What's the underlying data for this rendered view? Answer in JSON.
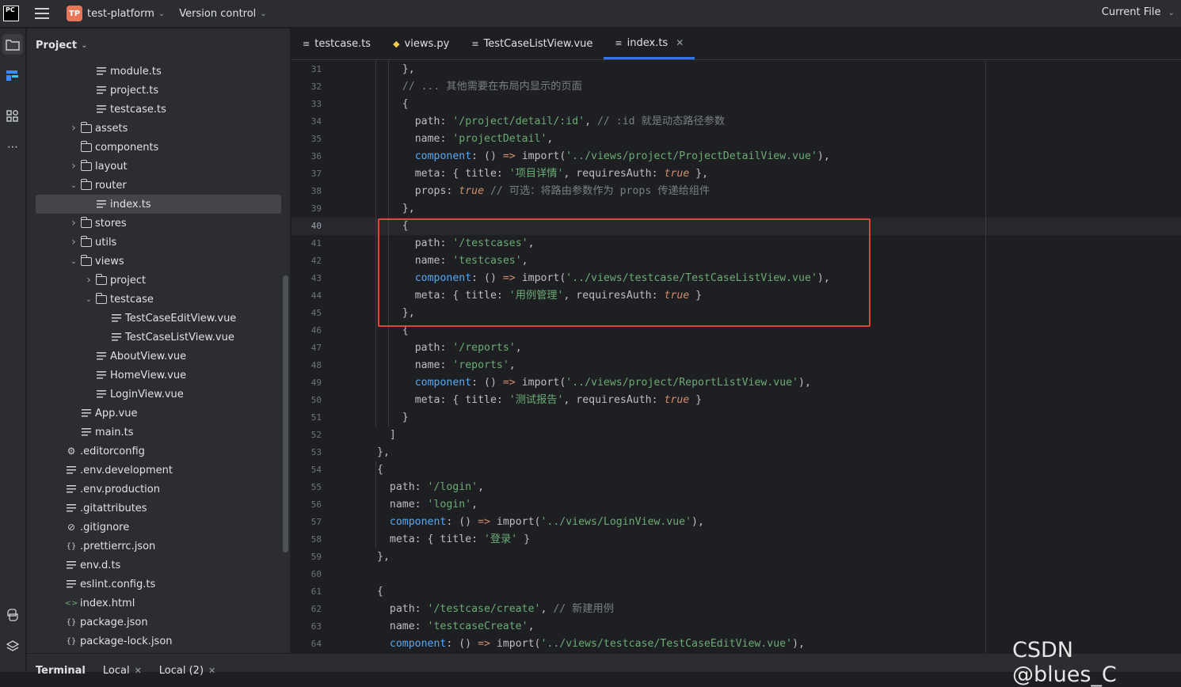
{
  "titlebar": {
    "app_logo": "PC",
    "project_badge": "TP",
    "project_name": "test-platform",
    "vcs_label": "Version control",
    "run_config": "Current File"
  },
  "left_strip": {
    "icons": [
      "folder-icon",
      "structure-icon",
      "plugins-icon",
      "more-icon",
      "python-console-icon",
      "layers-icon"
    ]
  },
  "project_panel": {
    "title": "Project",
    "tree": [
      {
        "label": "module.ts",
        "type": "file",
        "depth": 4
      },
      {
        "label": "project.ts",
        "type": "file",
        "depth": 4
      },
      {
        "label": "testcase.ts",
        "type": "file",
        "depth": 4
      },
      {
        "label": "assets",
        "type": "folder",
        "depth": 3,
        "expanded": false
      },
      {
        "label": "components",
        "type": "folder",
        "depth": 3,
        "expanded": null
      },
      {
        "label": "layout",
        "type": "folder",
        "depth": 3,
        "expanded": false
      },
      {
        "label": "router",
        "type": "folder",
        "depth": 3,
        "expanded": true
      },
      {
        "label": "index.ts",
        "type": "file",
        "depth": 4,
        "selected": true
      },
      {
        "label": "stores",
        "type": "folder",
        "depth": 3,
        "expanded": false
      },
      {
        "label": "utils",
        "type": "folder",
        "depth": 3,
        "expanded": false
      },
      {
        "label": "views",
        "type": "folder",
        "depth": 3,
        "expanded": true
      },
      {
        "label": "project",
        "type": "folder",
        "depth": 4,
        "expanded": false
      },
      {
        "label": "testcase",
        "type": "folder",
        "depth": 4,
        "expanded": true
      },
      {
        "label": "TestCaseEditView.vue",
        "type": "file",
        "depth": 5
      },
      {
        "label": "TestCaseListView.vue",
        "type": "file",
        "depth": 5
      },
      {
        "label": "AboutView.vue",
        "type": "file",
        "depth": 4
      },
      {
        "label": "HomeView.vue",
        "type": "file",
        "depth": 4
      },
      {
        "label": "LoginView.vue",
        "type": "file",
        "depth": 4
      },
      {
        "label": "App.vue",
        "type": "file",
        "depth": 3
      },
      {
        "label": "main.ts",
        "type": "file",
        "depth": 3
      },
      {
        "label": ".editorconfig",
        "type": "config",
        "depth": 2
      },
      {
        "label": ".env.development",
        "type": "file",
        "depth": 2
      },
      {
        "label": ".env.production",
        "type": "file",
        "depth": 2
      },
      {
        "label": ".gitattributes",
        "type": "file",
        "depth": 2
      },
      {
        "label": ".gitignore",
        "type": "ignore",
        "depth": 2
      },
      {
        "label": ".prettierrc.json",
        "type": "json",
        "depth": 2
      },
      {
        "label": "env.d.ts",
        "type": "file",
        "depth": 2
      },
      {
        "label": "eslint.config.ts",
        "type": "file",
        "depth": 2
      },
      {
        "label": "index.html",
        "type": "html",
        "depth": 2
      },
      {
        "label": "package.json",
        "type": "json",
        "depth": 2
      },
      {
        "label": "package-lock.json",
        "type": "json",
        "depth": 2
      }
    ]
  },
  "editor_tabs": [
    {
      "label": "testcase.ts",
      "icon": "ts-file-icon",
      "active": false
    },
    {
      "label": "views.py",
      "icon": "python-file-icon",
      "active": false
    },
    {
      "label": "TestCaseListView.vue",
      "icon": "vue-file-icon",
      "active": false
    },
    {
      "label": "index.ts",
      "icon": "ts-file-icon",
      "active": true
    }
  ],
  "editor": {
    "current_line": 40,
    "lines": [
      {
        "n": 31,
        "indent": 2,
        "tokens": [
          [
            "def",
            "},"
          ]
        ]
      },
      {
        "n": 32,
        "indent": 2,
        "tokens": [
          [
            "com",
            "// ... 其他需要在布局内显示的页面"
          ]
        ]
      },
      {
        "n": 33,
        "indent": 2,
        "tokens": [
          [
            "def",
            "{"
          ]
        ]
      },
      {
        "n": 34,
        "indent": 3,
        "tokens": [
          [
            "def",
            "path: "
          ],
          [
            "str",
            "'/project/detail/:id'"
          ],
          [
            "def",
            ", "
          ],
          [
            "com",
            "// :id 就是动态路径参数"
          ]
        ]
      },
      {
        "n": 35,
        "indent": 3,
        "tokens": [
          [
            "def",
            "name: "
          ],
          [
            "str",
            "'projectDetail'"
          ],
          [
            "def",
            ","
          ]
        ]
      },
      {
        "n": 36,
        "indent": 3,
        "tokens": [
          [
            "key",
            "component"
          ],
          [
            "def",
            ": () "
          ],
          [
            "kw",
            "=>"
          ],
          [
            "def",
            " import("
          ],
          [
            "str",
            "'../views/project/ProjectDetailView.vue'"
          ],
          [
            "def",
            "),"
          ]
        ]
      },
      {
        "n": 37,
        "indent": 3,
        "tokens": [
          [
            "def",
            "meta: { title: "
          ],
          [
            "str",
            "'项目详情'"
          ],
          [
            "def",
            ", requiresAuth: "
          ],
          [
            "true",
            "true"
          ],
          [
            "def",
            " },"
          ]
        ]
      },
      {
        "n": 38,
        "indent": 3,
        "tokens": [
          [
            "def",
            "props: "
          ],
          [
            "true",
            "true"
          ],
          [
            "def",
            " "
          ],
          [
            "com",
            "// 可选：将路由参数作为 props 传递给组件"
          ]
        ]
      },
      {
        "n": 39,
        "indent": 2,
        "tokens": [
          [
            "def",
            "},"
          ]
        ]
      },
      {
        "n": 40,
        "indent": 2,
        "tokens": [
          [
            "def",
            "{"
          ]
        ]
      },
      {
        "n": 41,
        "indent": 3,
        "tokens": [
          [
            "def",
            "path: "
          ],
          [
            "str",
            "'/testcases'"
          ],
          [
            "def",
            ","
          ]
        ]
      },
      {
        "n": 42,
        "indent": 3,
        "tokens": [
          [
            "def",
            "name: "
          ],
          [
            "str",
            "'testcases'"
          ],
          [
            "def",
            ","
          ]
        ]
      },
      {
        "n": 43,
        "indent": 3,
        "tokens": [
          [
            "key",
            "component"
          ],
          [
            "def",
            ": () "
          ],
          [
            "kw",
            "=>"
          ],
          [
            "def",
            " import("
          ],
          [
            "str",
            "'../views/testcase/TestCaseListView.vue'"
          ],
          [
            "def",
            "),"
          ]
        ]
      },
      {
        "n": 44,
        "indent": 3,
        "tokens": [
          [
            "def",
            "meta: { title: "
          ],
          [
            "str",
            "'用例管理'"
          ],
          [
            "def",
            ", requiresAuth: "
          ],
          [
            "true",
            "true"
          ],
          [
            "def",
            " }"
          ]
        ]
      },
      {
        "n": 45,
        "indent": 2,
        "tokens": [
          [
            "def",
            "},"
          ]
        ]
      },
      {
        "n": 46,
        "indent": 2,
        "tokens": [
          [
            "def",
            "{"
          ]
        ]
      },
      {
        "n": 47,
        "indent": 3,
        "tokens": [
          [
            "def",
            "path: "
          ],
          [
            "str",
            "'/reports'"
          ],
          [
            "def",
            ","
          ]
        ]
      },
      {
        "n": 48,
        "indent": 3,
        "tokens": [
          [
            "def",
            "name: "
          ],
          [
            "str",
            "'reports'"
          ],
          [
            "def",
            ","
          ]
        ]
      },
      {
        "n": 49,
        "indent": 3,
        "tokens": [
          [
            "key",
            "component"
          ],
          [
            "def",
            ": () "
          ],
          [
            "kw",
            "=>"
          ],
          [
            "def",
            " import("
          ],
          [
            "str",
            "'../views/project/ReportListView.vue'"
          ],
          [
            "def",
            "),"
          ]
        ]
      },
      {
        "n": 50,
        "indent": 3,
        "tokens": [
          [
            "def",
            "meta: { title: "
          ],
          [
            "str",
            "'测试报告'"
          ],
          [
            "def",
            ", requiresAuth: "
          ],
          [
            "true",
            "true"
          ],
          [
            "def",
            " }"
          ]
        ]
      },
      {
        "n": 51,
        "indent": 2,
        "tokens": [
          [
            "def",
            "}"
          ]
        ]
      },
      {
        "n": 52,
        "indent": 1,
        "tokens": [
          [
            "def",
            "]"
          ]
        ]
      },
      {
        "n": 53,
        "indent": 0,
        "tokens": [
          [
            "def",
            "},"
          ]
        ]
      },
      {
        "n": 54,
        "indent": 0,
        "tokens": [
          [
            "def",
            "{"
          ]
        ]
      },
      {
        "n": 55,
        "indent": 1,
        "tokens": [
          [
            "def",
            "path: "
          ],
          [
            "str",
            "'/login'"
          ],
          [
            "def",
            ","
          ]
        ]
      },
      {
        "n": 56,
        "indent": 1,
        "tokens": [
          [
            "def",
            "name: "
          ],
          [
            "str",
            "'login'"
          ],
          [
            "def",
            ","
          ]
        ]
      },
      {
        "n": 57,
        "indent": 1,
        "tokens": [
          [
            "key",
            "component"
          ],
          [
            "def",
            ": () "
          ],
          [
            "kw",
            "=>"
          ],
          [
            "def",
            " import("
          ],
          [
            "str",
            "'../views/LoginView.vue'"
          ],
          [
            "def",
            "),"
          ]
        ]
      },
      {
        "n": 58,
        "indent": 1,
        "tokens": [
          [
            "def",
            "meta: { title: "
          ],
          [
            "str",
            "'登录'"
          ],
          [
            "def",
            " }"
          ]
        ]
      },
      {
        "n": 59,
        "indent": 0,
        "tokens": [
          [
            "def",
            "},"
          ]
        ]
      },
      {
        "n": 60,
        "indent": 0,
        "tokens": []
      },
      {
        "n": 61,
        "indent": 0,
        "tokens": [
          [
            "def",
            "{"
          ]
        ]
      },
      {
        "n": 62,
        "indent": 1,
        "tokens": [
          [
            "def",
            "path: "
          ],
          [
            "str",
            "'/testcase/create'"
          ],
          [
            "def",
            ", "
          ],
          [
            "com",
            "// 新建用例"
          ]
        ]
      },
      {
        "n": 63,
        "indent": 1,
        "tokens": [
          [
            "def",
            "name: "
          ],
          [
            "str",
            "'testcaseCreate'"
          ],
          [
            "def",
            ","
          ]
        ]
      },
      {
        "n": 64,
        "indent": 1,
        "tokens": [
          [
            "key",
            "component"
          ],
          [
            "def",
            ": () "
          ],
          [
            "kw",
            "=>"
          ],
          [
            "def",
            " import("
          ],
          [
            "str",
            "'../views/testcase/TestCaseEditView.vue'"
          ],
          [
            "def",
            "),"
          ]
        ]
      }
    ]
  },
  "bottom_tabs": [
    {
      "label": "Terminal",
      "active": true,
      "closable": false
    },
    {
      "label": "Local",
      "active": false,
      "closable": true
    },
    {
      "label": "Local (2)",
      "active": false,
      "closable": true
    }
  ],
  "watermark": "CSDN @blues_C"
}
